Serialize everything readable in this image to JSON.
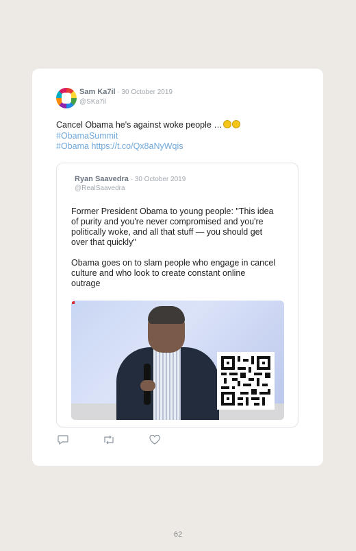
{
  "tweet": {
    "author_name": "Sam Ka7il",
    "separator": " · ",
    "date": "30 October 2019",
    "handle": "@SKa7il",
    "text": "Cancel Obama he's against woke people …",
    "hashtag1": "#ObamaSummit",
    "hashtag2": "#Obama",
    "link": "https://t.co/Qx8aNyWqis"
  },
  "quoted": {
    "author_name": "Ryan Saavedra",
    "separator": " · ",
    "date": "30 October 2019",
    "handle": "@RealSaavedra",
    "paragraph1": "Former President Obama to young people: \"This idea of purity and you're never compromised and you're politically woke, and all that stuff — you should get over that quickly\"",
    "paragraph2": "Obama goes on to slam people who engage in cancel culture and who look to create constant online outrage"
  },
  "actions": {
    "icons": [
      "reply-icon",
      "retweet-icon",
      "like-icon"
    ]
  },
  "footer": {
    "page_number": "62"
  },
  "colors": {
    "page_bg": "#ede9e4",
    "link": "#6fa8dc",
    "muted": "#a0a8b0"
  }
}
